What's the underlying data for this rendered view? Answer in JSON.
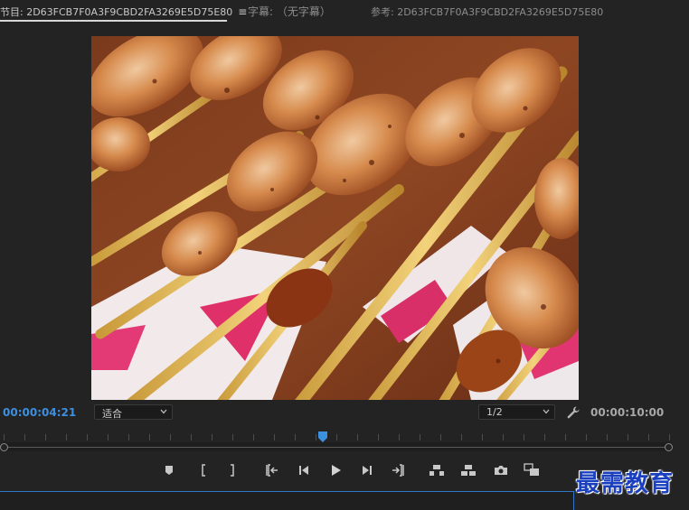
{
  "tabs": {
    "program": "节目: 2D63FCB7F0A3F9CBD2FA3269E5D75E80",
    "program_menu": "≡",
    "captions": "字幕: （无字幕）",
    "reference": "参考: 2D63FCB7F0A3F9CBD2FA3269E5D75E80"
  },
  "viewer": {
    "timecode_current": "00:00:04:21",
    "timecode_duration": "00:00:10:00",
    "fit_select": "适合",
    "resolution_select": "1/2",
    "playhead_fraction": 0.48
  },
  "controls": [
    {
      "name": "add-marker-button",
      "icon": "marker-icon"
    },
    {
      "name": "mark-in-button",
      "icon": "mark-in-icon"
    },
    {
      "name": "mark-out-button",
      "icon": "mark-out-icon"
    },
    {
      "name": "go-to-in-button",
      "icon": "go-to-in-icon"
    },
    {
      "name": "step-back-button",
      "icon": "step-back-icon"
    },
    {
      "name": "play-button",
      "icon": "play-icon"
    },
    {
      "name": "step-forward-button",
      "icon": "step-forward-icon"
    },
    {
      "name": "go-to-out-button",
      "icon": "go-to-out-icon"
    },
    {
      "name": "lift-button",
      "icon": "lift-icon"
    },
    {
      "name": "extract-button",
      "icon": "extract-icon"
    },
    {
      "name": "export-frame-button",
      "icon": "camera-icon"
    },
    {
      "name": "comparison-view-button",
      "icon": "compare-icon"
    }
  ],
  "watermark": "最需教育",
  "colors": {
    "timecode_accent": "#3d8fe0",
    "panel_bg": "#232323",
    "watermark": "#1a3fbf"
  }
}
